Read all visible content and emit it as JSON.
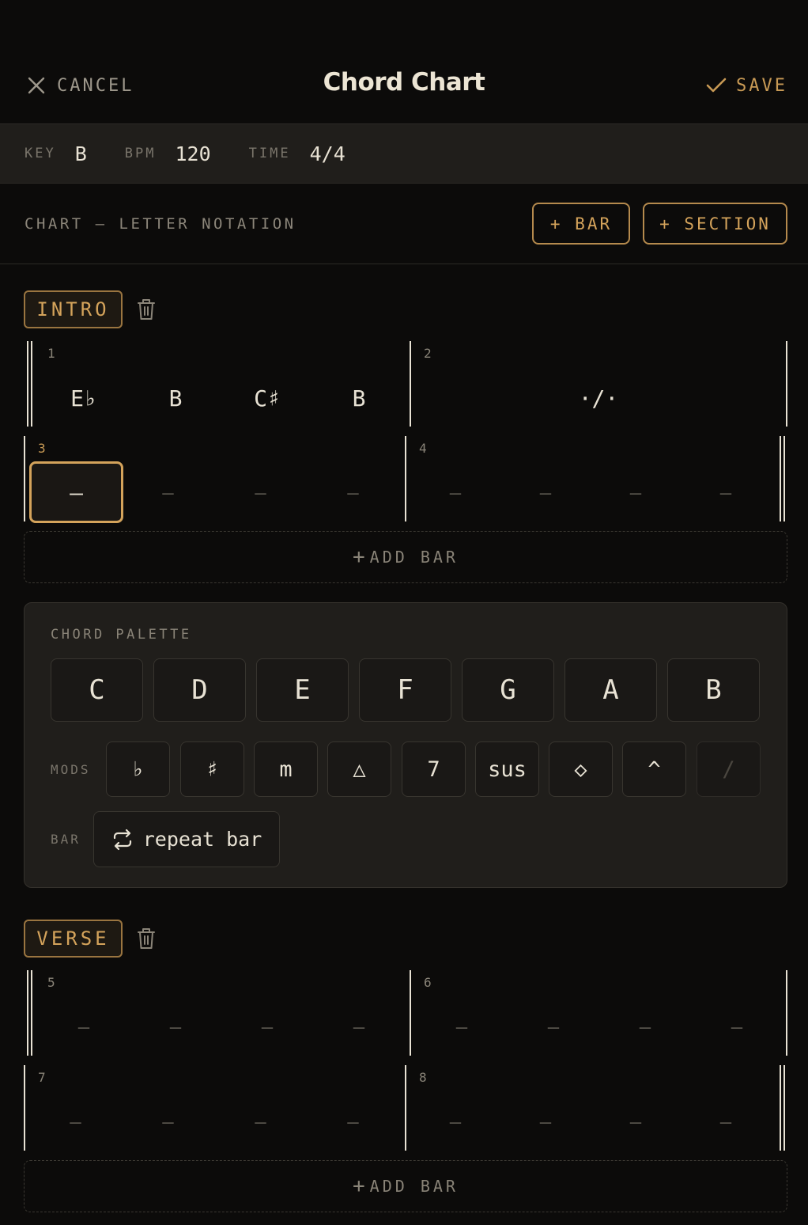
{
  "header": {
    "cancel_label": "CANCEL",
    "title": "Chord Chart",
    "save_label": "SAVE"
  },
  "meta": {
    "key_label": "KEY",
    "key_value": "B",
    "bpm_label": "BPM",
    "bpm_value": "120",
    "time_label": "TIME",
    "time_value": "4/4"
  },
  "toolbar": {
    "chart_label": "CHART — LETTER NOTATION",
    "add_bar_label": "+ BAR",
    "add_section_label": "+ SECTION"
  },
  "sections": [
    {
      "name": "INTRO",
      "bars": [
        {
          "number": "1",
          "beats": [
            "E♭",
            "B",
            "C♯",
            "B"
          ]
        },
        {
          "number": "2",
          "repeat": "·/·"
        },
        {
          "number": "3",
          "beats": [
            "—",
            "—",
            "—",
            "—"
          ],
          "selected_beat": 0
        },
        {
          "number": "4",
          "beats": [
            "—",
            "—",
            "—",
            "—"
          ]
        }
      ],
      "add_bar_label": "ADD BAR"
    },
    {
      "name": "VERSE",
      "bars": [
        {
          "number": "5",
          "beats": [
            "—",
            "—",
            "—",
            "—"
          ]
        },
        {
          "number": "6",
          "beats": [
            "—",
            "—",
            "—",
            "—"
          ]
        },
        {
          "number": "7",
          "beats": [
            "—",
            "—",
            "—",
            "—"
          ]
        },
        {
          "number": "8",
          "beats": [
            "—",
            "—",
            "—",
            "—"
          ]
        }
      ],
      "add_bar_label": "ADD BAR"
    }
  ],
  "palette": {
    "title": "CHORD PALETTE",
    "notes": [
      "C",
      "D",
      "E",
      "F",
      "G",
      "A",
      "B"
    ],
    "mods_label": "MODS",
    "mods": [
      "♭",
      "♯",
      "m",
      "△",
      "7",
      "sus",
      "◇",
      "^",
      "/"
    ],
    "bar_label": "BAR",
    "repeat_label": "repeat bar"
  },
  "colors": {
    "background": "#0c0b0a",
    "accent": "#d4a35b",
    "panel": "#201e1b"
  }
}
